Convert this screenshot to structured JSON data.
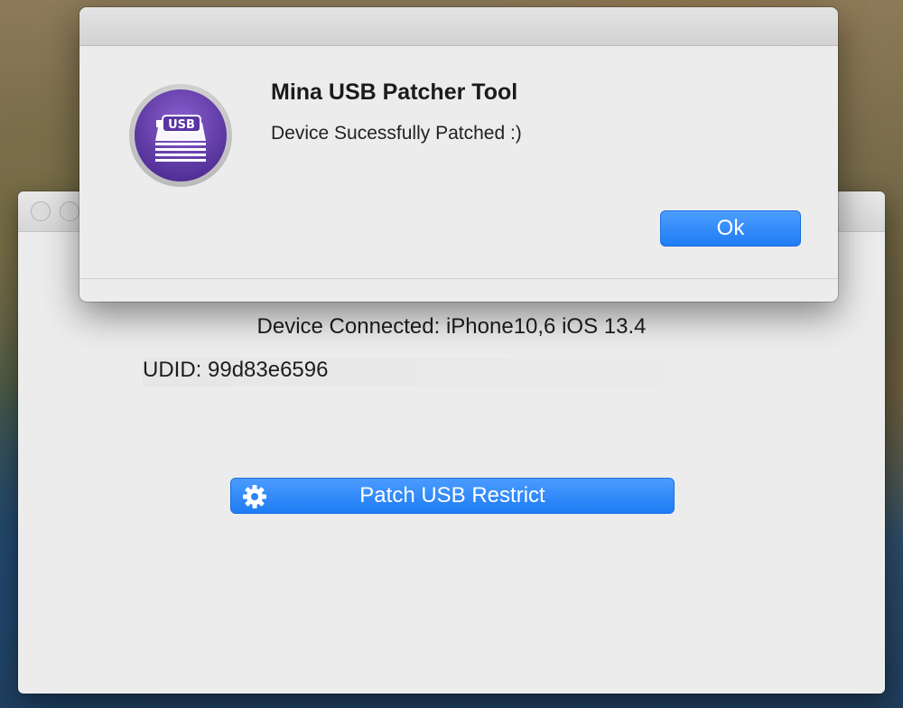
{
  "main_window": {
    "device_connected": "Device Connected: iPhone10,6 iOS 13.4",
    "udid": "UDID: 99d83e6596",
    "patch_button_label": "Patch USB Restrict"
  },
  "alert": {
    "title": "Mina USB Patcher Tool",
    "message": "Device Sucessfully Patched :)",
    "ok_label": "Ok",
    "icon_text": "USB"
  },
  "icons": {
    "app_icon": "usb-drive-icon",
    "patch_button_icon": "gear-icon"
  },
  "colors": {
    "accent_blue": "#1f7cf4",
    "icon_purple": "#6b3fb0",
    "window_bg": "#ececec"
  }
}
